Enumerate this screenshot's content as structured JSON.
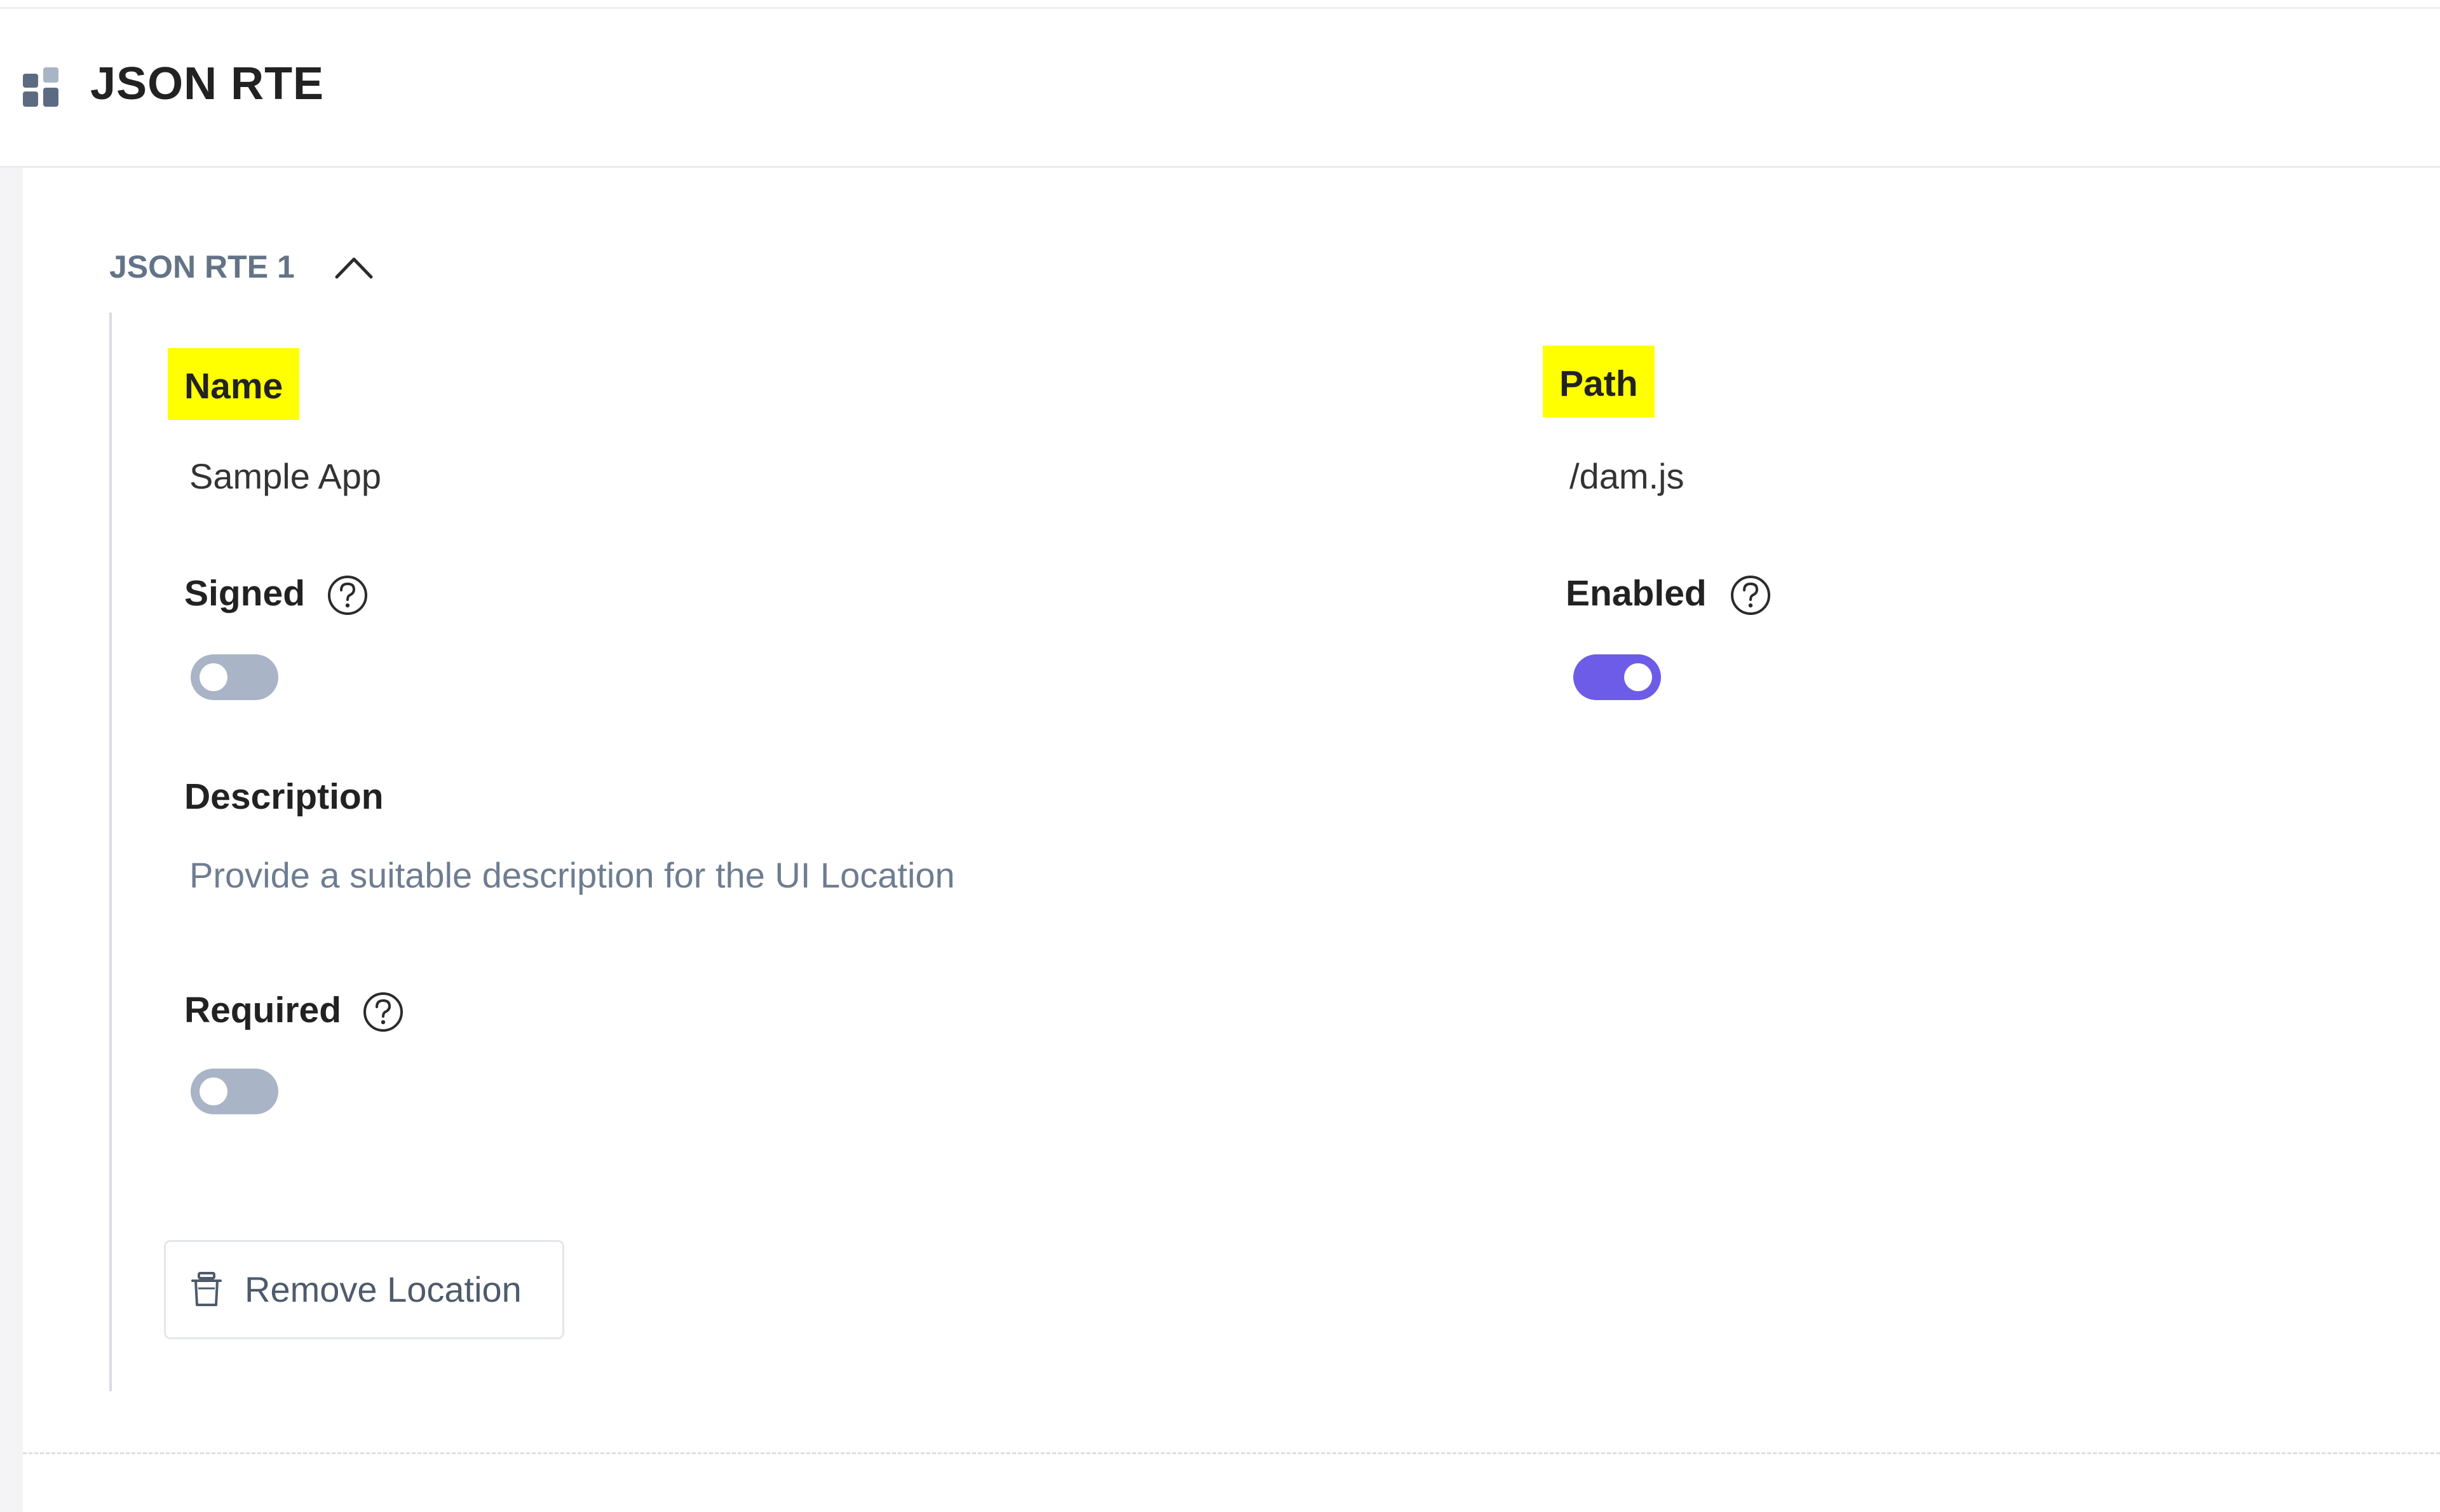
{
  "header": {
    "title": "JSON RTE",
    "icon": "widgets-icon"
  },
  "location": {
    "title": "JSON RTE 1",
    "expanded": true,
    "fields": {
      "name": {
        "label": "Name",
        "value": "Sample App"
      },
      "path": {
        "label": "Path",
        "value": "/dam.js"
      },
      "signed": {
        "label": "Signed",
        "checked": false
      },
      "enabled": {
        "label": "Enabled",
        "checked": true
      },
      "description": {
        "label": "Description",
        "placeholder": "Provide a suitable description for the UI Location"
      },
      "required": {
        "label": "Required",
        "checked": false
      }
    },
    "remove_label": "Remove Location"
  },
  "colors": {
    "accent": "#6c5ce7",
    "toggle_off": "#a9b4c7",
    "highlight": "#ffff00",
    "section_title": "#647386"
  }
}
